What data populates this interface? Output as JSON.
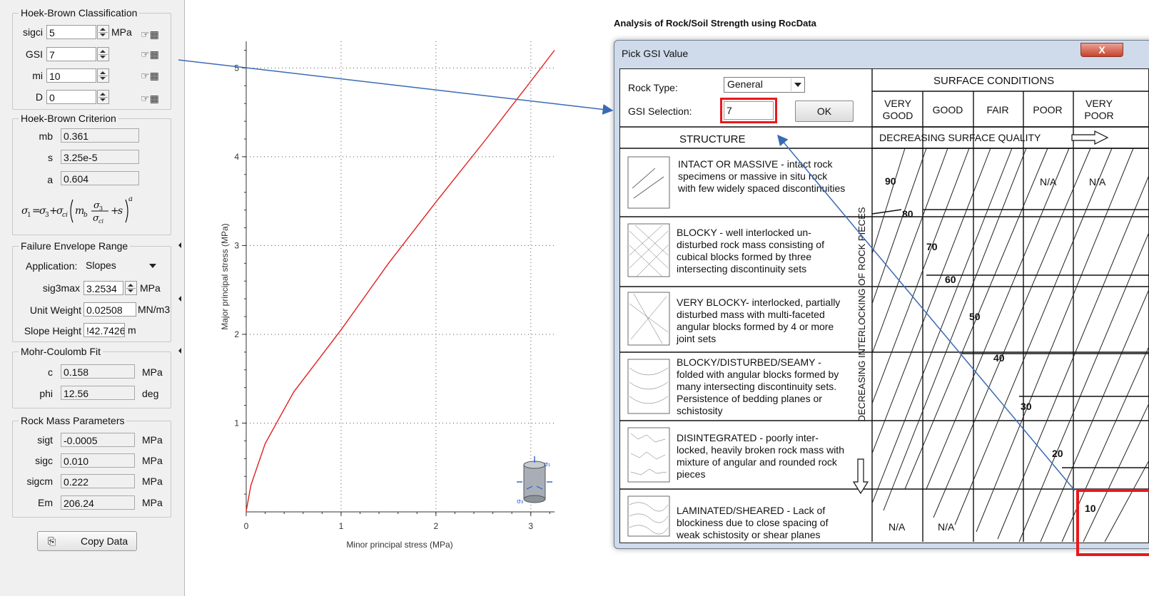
{
  "hoek_brown_classification": {
    "title": "Hoek-Brown Classification",
    "sigci_label": "sigci",
    "sigci_value": "5",
    "sigci_unit": "MPa",
    "gsi_label": "GSI",
    "gsi_value": "7",
    "mi_label": "mi",
    "mi_value": "10",
    "d_label": "D",
    "d_value": "0"
  },
  "hoek_brown_criterion": {
    "title": "Hoek-Brown Criterion",
    "mb_label": "mb",
    "mb_value": "0.361",
    "s_label": "s",
    "s_value": "3.25e-5",
    "a_label": "a",
    "a_value": "0.604"
  },
  "failure_envelope": {
    "title": "Failure Envelope Range",
    "application_label": "Application:",
    "application_value": "Slopes",
    "sig3max_label": "sig3max",
    "sig3max_value": "3.2534",
    "sig3max_unit": "MPa",
    "unit_weight_label": "Unit Weight",
    "unit_weight_value": "0.02508",
    "unit_weight_unit": "MN/m3",
    "slope_height_label": "Slope Height",
    "slope_height_value": "!42.7426",
    "slope_height_unit": "m"
  },
  "mohr_coulomb": {
    "title": "Mohr-Coulomb Fit",
    "c_label": "c",
    "c_value": "0.158",
    "c_unit": "MPa",
    "phi_label": "phi",
    "phi_value": "12.56",
    "phi_unit": "deg"
  },
  "rock_mass": {
    "title": "Rock Mass Parameters",
    "sigt_label": "sigt",
    "sigt_value": "-0.0005",
    "sigt_unit": "MPa",
    "sigc_label": "sigc",
    "sigc_value": "0.010",
    "sigc_unit": "MPa",
    "sigcm_label": "sigcm",
    "sigcm_value": "0.222",
    "sigcm_unit": "MPa",
    "em_label": "Em",
    "em_value": "206.24",
    "em_unit": "MPa"
  },
  "copy_data_label": "Copy Data",
  "chart_data": {
    "type": "line",
    "xlabel": "Minor principal stress (MPa)",
    "ylabel": "Major principal stress (MPa)",
    "xlim": [
      0,
      3.25
    ],
    "ylim": [
      0,
      5.3
    ],
    "x_ticks": [
      "0",
      "1",
      "2",
      "3"
    ],
    "y_ticks": [
      "1",
      "2",
      "3",
      "4",
      "5"
    ],
    "grid": "dotted",
    "series": [
      {
        "x": [
          0,
          0.05,
          0.2,
          0.5,
          1.0,
          1.5,
          2.0,
          2.5,
          3.0,
          3.25
        ],
        "y": [
          0.01,
          0.3,
          0.77,
          1.35,
          2.05,
          2.8,
          3.49,
          4.16,
          4.85,
          5.2
        ]
      }
    ],
    "line_color": "#e02020"
  },
  "page_caption": "Analysis of Rock/Soil Strength using RocData",
  "dialog": {
    "title": "Pick GSI Value",
    "close_label": "X",
    "rock_type_label": "Rock Type:",
    "rock_type_value": "General",
    "gsi_selection_label": "GSI Selection:",
    "gsi_selection_value": "7",
    "ok_label": "OK",
    "surface_conditions": "SURFACE CONDITIONS",
    "columns": [
      "VERY GOOD",
      "GOOD",
      "FAIR",
      "POOR",
      "VERY POOR"
    ],
    "structure_header": "STRUCTURE",
    "decreasing_surface": "DECREASING SURFACE QUALITY",
    "decreasing_interlocking": "DECREASING INTERLOCKING OF ROCK PIECES",
    "structures": [
      "INTACT OR MASSIVE - intact rock specimens or massive in situ rock with few widely spaced discontinuities",
      "BLOCKY - well interlocked un-disturbed rock mass consisting of cubical blocks formed by three intersecting discontinuity sets",
      "VERY BLOCKY- interlocked, partially disturbed mass with multi-faceted angular blocks formed by 4 or more joint sets",
      "BLOCKY/DISTURBED/SEAMY - folded with angular blocks formed by many intersecting discontinuity sets. Persistence of bedding planes or schistosity",
      "DISINTEGRATED - poorly inter-locked, heavily broken rock mass with mixture of angular and rounded rock pieces",
      "LAMINATED/SHEARED - Lack of blockiness due to close spacing of weak schistosity or shear planes"
    ],
    "gsi_labels": [
      "90",
      "80",
      "70",
      "60",
      "50",
      "40",
      "30",
      "20",
      "10"
    ],
    "na_label": "N/A"
  },
  "colors": {
    "highlight": "#e8191c",
    "annotation_arrow": "#3a6ab4",
    "curve": "#e02020"
  }
}
